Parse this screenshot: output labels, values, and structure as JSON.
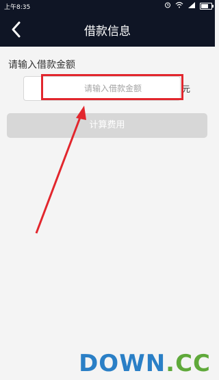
{
  "status_bar": {
    "time": "上午8:35",
    "icons": [
      "alarm-icon",
      "wifi-icon",
      "signal-icon",
      "battery-icon"
    ],
    "battery_level": 0.7
  },
  "nav": {
    "back_icon": "chevron-left-icon",
    "title": "借款信息"
  },
  "form": {
    "prompt": "请输入借款金额",
    "amount_placeholder": "请输入借款金额",
    "amount_value": "",
    "unit": "元",
    "calculate_label": "计算费用"
  },
  "annotation": {
    "highlight_color": "#e2262d",
    "arrow_color": "#e2262d"
  },
  "watermark": {
    "main": "DOWN",
    "ext": ".CC"
  },
  "colors": {
    "header_bg": "#0f1525",
    "page_bg": "#f4f4f4",
    "button_disabled": "#d7d7d7"
  }
}
